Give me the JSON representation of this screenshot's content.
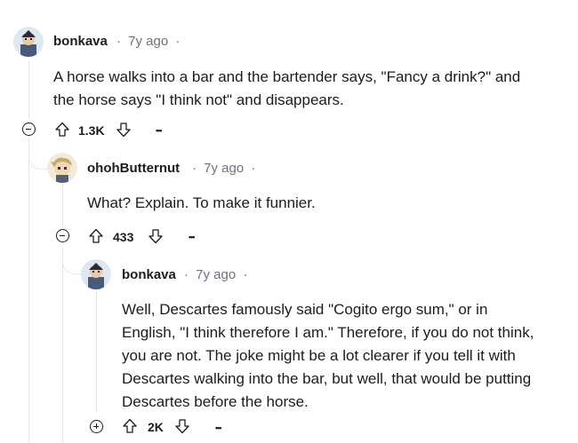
{
  "comments": [
    {
      "username": "bonkava",
      "age": "7y ago",
      "separator": "·",
      "trailing": "·",
      "body_lines": [
        "A horse walks into a bar and the bartender says, \"Fancy a drink?\" and",
        "the horse says \"I think not\" and disappears."
      ],
      "votes": "1.3K",
      "more": "•••",
      "collapsed": false
    },
    {
      "username": "ohohButternut",
      "age": "7y ago",
      "separator": "·",
      "trailing": "·",
      "body_lines": [
        "What? Explain. To make it funnier."
      ],
      "votes": "433",
      "more": "•••",
      "collapsed": false
    },
    {
      "username": "bonkava",
      "age": "7y ago",
      "separator": "·",
      "trailing": "·",
      "body_lines": [
        "Well, Descartes famously said \"Cogito ergo sum,\" or in",
        "English, \"I think therefore I am.\" Therefore, if you do not think,",
        "you are not. The joke might be a lot clearer if you tell it with",
        "Descartes walking into the bar, but well, that would be putting",
        "Descartes before the horse."
      ],
      "votes": "2K",
      "more": "•••",
      "collapsed": true
    }
  ],
  "colors": {
    "text": "#1c1c1c",
    "meta": "#6b7280",
    "thread_line": "#e5e7ea"
  }
}
